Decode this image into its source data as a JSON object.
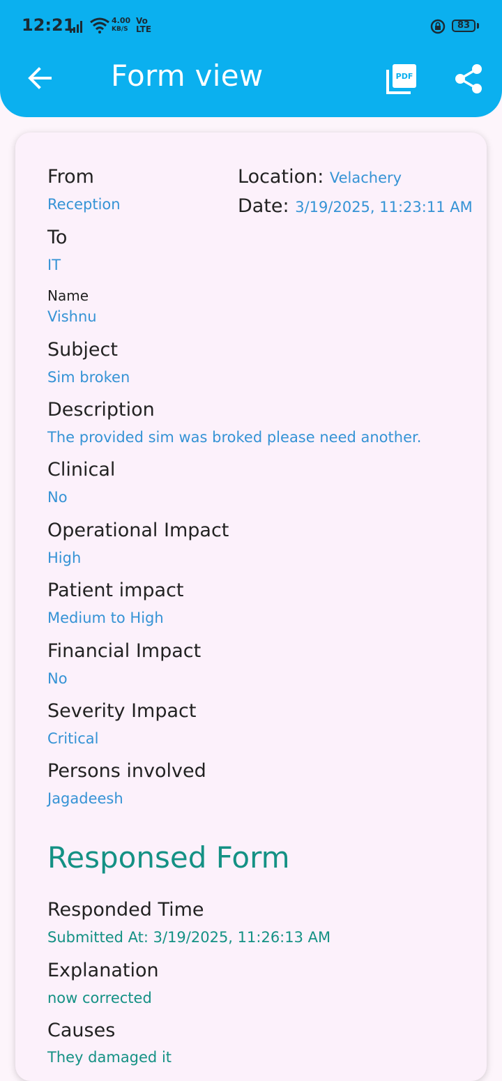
{
  "status_bar": {
    "time": "12:21",
    "net_speed_top": "4.00",
    "net_speed_bottom": "KB/S",
    "volte_top": "Vo",
    "volte_bottom": "LTE",
    "battery": "83"
  },
  "app_bar": {
    "title": "Form view",
    "back_icon": "arrow-left-icon",
    "pdf_icon": "pdf-icon",
    "share_icon": "share-icon",
    "background": "#0bb0ef"
  },
  "form": {
    "from_label": "From",
    "from_value": "Reception",
    "location_label": "Location:",
    "location_value": "Velachery",
    "date_label": "Date:",
    "date_value": "3/19/2025, 11:23:11 AM",
    "to_label": "To",
    "to_value": "IT",
    "name_label": "Name",
    "name_value": "Vishnu",
    "subject_label": "Subject",
    "subject_value": "Sim broken",
    "description_label": "Description",
    "description_value": "The provided sim was broked please need another.",
    "clinical_label": "Clinical",
    "clinical_value": "No",
    "operational_label": "Operational Impact",
    "operational_value": "High",
    "patient_label": "Patient impact",
    "patient_value": "Medium to High",
    "financial_label": "Financial Impact",
    "financial_value": "No",
    "severity_label": "Severity Impact",
    "severity_value": "Critical",
    "persons_label": "Persons involved",
    "persons_value": "Jagadeesh"
  },
  "response": {
    "section_title": "Responsed Form",
    "responded_time_label": "Responded Time",
    "responded_time_value": "Submitted At: 3/19/2025, 11:26:13 AM",
    "explanation_label": "Explanation",
    "explanation_value": "now corrected",
    "causes_label": "Causes",
    "causes_value": "They damaged it"
  },
  "colors": {
    "value_blue": "#3593d5",
    "response_teal": "#149184",
    "card_bg": "#fcf1fb"
  }
}
